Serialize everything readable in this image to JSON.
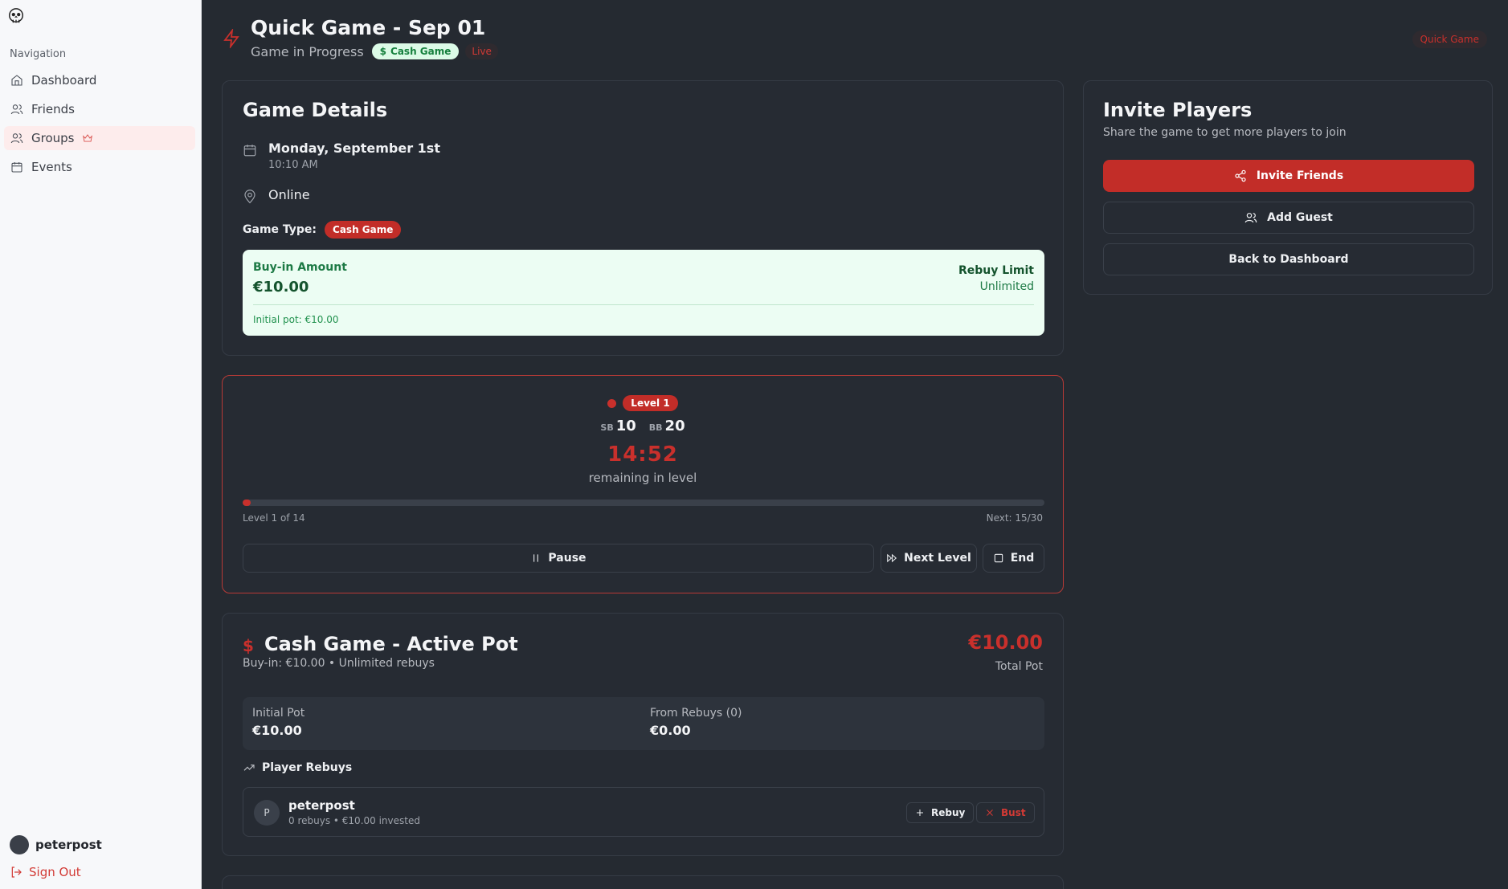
{
  "sidebar": {
    "nav_heading": "Navigation",
    "items": [
      {
        "label": "Dashboard",
        "icon": "home-icon"
      },
      {
        "label": "Friends",
        "icon": "users-icon"
      },
      {
        "label": "Groups",
        "icon": "users-icon",
        "active": true,
        "badge_icon": "crown-icon"
      },
      {
        "label": "Events",
        "icon": "calendar-icon"
      }
    ],
    "username": "peterpost",
    "sign_out": "Sign Out"
  },
  "header": {
    "title": "Quick Game - Sep 01",
    "subtitle": "Game in Progress",
    "type_pill": "Cash Game",
    "live_pill": "Live",
    "badge": "Quick Game"
  },
  "game_details": {
    "title": "Game Details",
    "date": "Monday, September 1st",
    "time": "10:10 AM",
    "location": "Online",
    "game_type_label": "Game Type:",
    "game_type": "Cash Game",
    "buyin_label": "Buy-in Amount",
    "buyin_amount": "€10.00",
    "rebuy_label": "Rebuy Limit",
    "rebuy_value": "Unlimited",
    "initial_pot": "Initial pot: €10.00"
  },
  "timer": {
    "level": "Level 1",
    "sb_label": "SB",
    "sb_value": "10",
    "bb_label": "BB",
    "bb_value": "20",
    "clock": "14:52",
    "clock_sub": "remaining in level",
    "progress": 0.01,
    "level_of": "Level 1 of 14",
    "next": "Next: 15/30",
    "pause": "Pause",
    "next_level": "Next Level",
    "end": "End"
  },
  "pot": {
    "icon": "$",
    "title": "Cash Game - Active Pot",
    "subtitle": "Buy-in: €10.00 • Unlimited rebuys",
    "total": "€10.00",
    "total_label": "Total Pot",
    "initial_pot_label": "Initial Pot",
    "initial_pot_value": "€10.00",
    "from_rebuys_label": "From Rebuys (0)",
    "from_rebuys_value": "€0.00",
    "rebuys_heading": "Player Rebuys",
    "players": [
      {
        "initial": "P",
        "name": "peterpost",
        "meta": "0 rebuys • €10.00 invested",
        "rebuy": "Rebuy",
        "bust": "Bust"
      }
    ]
  },
  "invite": {
    "title": "Invite Players",
    "subtitle": "Share the game to get more players to join",
    "invite_friends": "Invite Friends",
    "add_guest": "Add Guest",
    "back": "Back to Dashboard"
  },
  "colors": {
    "accent": "#c22d28",
    "success_bg": "#ecfdf3",
    "background": "#252a31",
    "sidebar": "#f7f8fa"
  }
}
